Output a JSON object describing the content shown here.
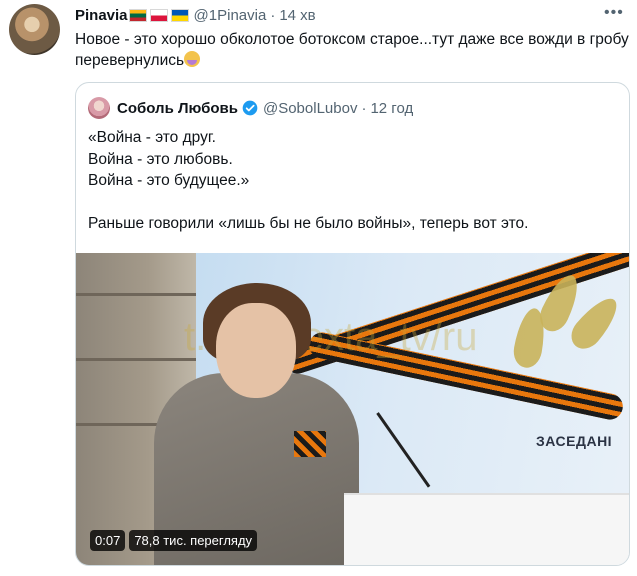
{
  "tweet": {
    "author_name": "Pinavia",
    "flags": [
      "flag-lithuania-icon",
      "flag-poland-icon",
      "flag-ukraine-icon"
    ],
    "handle": "@1Pinavia",
    "separator": "·",
    "time": "14 хв",
    "more_icon": "ellipsis-icon",
    "text": "Новое - это хорошо обколотое ботоксом старое...тут даже все вожди в гробу перевернулись",
    "emoji": "face-palm-emoji"
  },
  "quote": {
    "author_name": "Соболь Любовь",
    "verified_icon": "verified-badge-icon",
    "handle": "@SobolLubov",
    "separator": "·",
    "time": "12 год",
    "text": "«Война - это друг.\nВойна - это любовь.\nВойна - это будущее.»\n\nРаньше говорили «лишь бы не было войны», теперь вот это.",
    "video": {
      "watermark": "t.me/Nexta_tv/ru",
      "sign_text": "ЗАСЕДАНІ",
      "duration": "0:07",
      "views": "78,8 тис. перегляду"
    }
  },
  "colors": {
    "text": "#0f1419",
    "secondary": "#536471",
    "verified": "#1d9bf0",
    "border": "#cfd9de"
  }
}
